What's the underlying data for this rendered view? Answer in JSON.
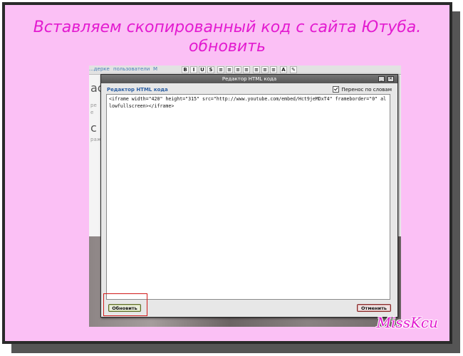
{
  "slide": {
    "heading_line1": "Вставляем скопированный код с сайта Ютуба.",
    "heading_line2": "обновить",
    "signature": "MissKcu"
  },
  "background_editor": {
    "tabs": [
      "...дерке",
      "пользователи",
      "М"
    ],
    "tools": [
      "B",
      "I",
      "U",
      "S",
      "≡",
      "≡",
      "≡",
      "≡",
      "≡",
      "≡",
      "≡",
      "A",
      "✎"
    ],
    "side_letters": [
      "ас",
      "ре",
      "е",
      "с",
      "раже"
    ]
  },
  "dialog": {
    "title": "Редактор HTML кода",
    "header": "Редактор HTML кода",
    "wrap_label": "Перенос по словам",
    "wrap_checked": true,
    "code": "<iframe width=\"420\" height=\"315\" src=\"http://www.youtube.com/embed/Hct9jeMDxT4\" frameborder=\"0\" allowfullscreen></iframe>",
    "refresh_label": "Обновить",
    "cancel_label": "Отменить",
    "minimize_glyph": "_",
    "close_glyph": "✕"
  },
  "colors": {
    "slide_background": "#fbc0f5",
    "heading_text": "#e31bd0",
    "highlight": "#d11a1a",
    "dialog_header_text": "#2c5fa3"
  }
}
